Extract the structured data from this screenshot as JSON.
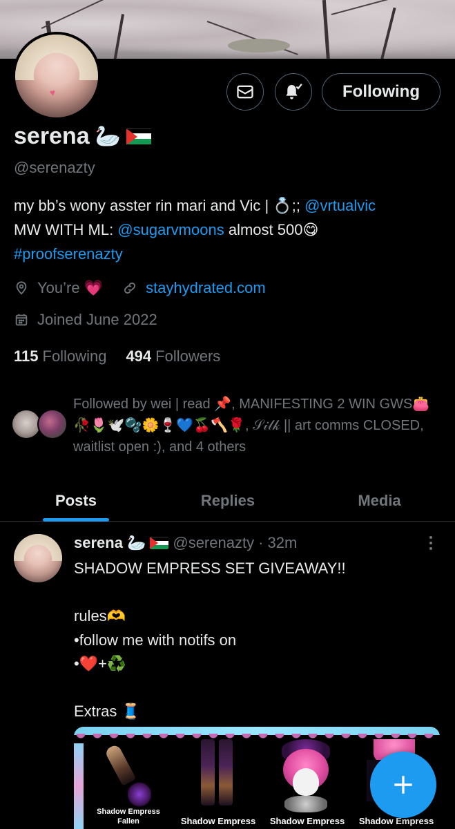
{
  "profile": {
    "display_name": "serena",
    "name_emoji": "🦢",
    "handle": "@serenazty",
    "bio": {
      "line1_text": "my bb’s wony asster rin mari and Vic | ",
      "line1_emoji": "💍;; ",
      "line1_link": "@vrtualvic",
      "line2_text": "MW WITH ML: ",
      "line2_link": "@sugarvmoons",
      "line2_tail": " almost 500😋",
      "line3_hashtag": "#proofserenazty"
    },
    "location": "You’re 💗",
    "website": "stayhydrated.com",
    "joined": "Joined June 2022",
    "following_count": "115",
    "following_label": "Following",
    "followers_count": "494",
    "followers_label": "Followers",
    "followed_by": "Followed by wei | read 📌, MANIFESTING 2 WIN GWS👛🥀🌷🕊️🫧🌼🍷💙🍒🪓🌹, 𝒮𝒾𝓁𝓀 || art comms CLOSED, waitlist open :), and 4 others"
  },
  "actions": {
    "message_icon": "envelope-icon",
    "notify_icon": "bell-check-icon",
    "following_button": "Following"
  },
  "tabs": [
    "Posts",
    "Replies",
    "Media"
  ],
  "post": {
    "name": "serena",
    "name_emoji": "🦢",
    "handle": "@serenazty",
    "time": "· 32m",
    "text": "SHADOW EMPRESS SET GIVEAWAY!!\n\nrules🫶\n•follow me with notifs on\n•❤️+♻️\n\nExtras 🧵",
    "media_items": [
      "Shadow Empress Fallen",
      "Shadow Empress",
      "Shadow Empress",
      "Shadow Empress"
    ]
  },
  "colors": {
    "accent": "#1d9bf0",
    "secondary_text": "#71767b",
    "primary_text": "#e7e9ea"
  }
}
